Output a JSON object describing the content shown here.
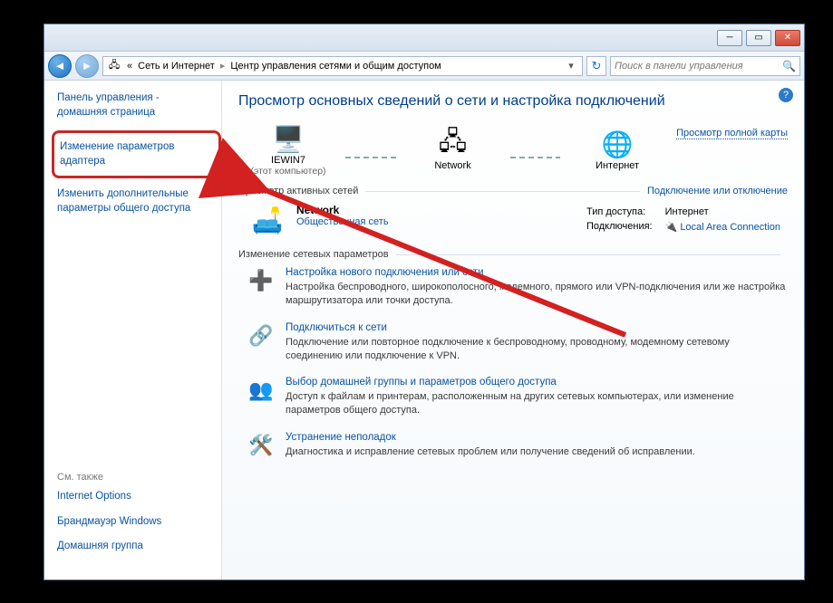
{
  "breadcrumb": {
    "prefix": "«",
    "seg1": "Сеть и Интернет",
    "seg2": "Центр управления сетями и общим доступом"
  },
  "search": {
    "placeholder": "Поиск в панели управления"
  },
  "sidebar": {
    "home": "Панель управления - домашняя страница",
    "adapter": "Изменение параметров адаптера",
    "sharing": "Изменить дополнительные параметры общего доступа",
    "see_also": "См. также",
    "internet_options": "Internet Options",
    "firewall": "Брандмауэр Windows",
    "homegroup": "Домашняя группа"
  },
  "main": {
    "heading": "Просмотр основных сведений о сети и настройка подключений",
    "map": {
      "node1": "IEWIN7",
      "node1_sub": "(этот компьютер)",
      "node2": "Network",
      "node3": "Интернет",
      "full_map": "Просмотр полной карты"
    },
    "active_hdr": "Просмотр активных сетей",
    "active_link": "Подключение или отключение",
    "network": {
      "name": "Network",
      "type": "Общественная сеть",
      "access_label": "Тип доступа:",
      "access_value": "Интернет",
      "conn_label": "Подключения:",
      "conn_value": "Local Area Connection"
    },
    "change_hdr": "Изменение сетевых параметров",
    "items": [
      {
        "title": "Настройка нового подключения или сети",
        "desc": "Настройка беспроводного, широкополосного, модемного, прямого или VPN-подключения или же настройка маршрутизатора или точки доступа."
      },
      {
        "title": "Подключиться к сети",
        "desc": "Подключение или повторное подключение к беспроводному, проводному, модемному сетевому соединению или подключение к VPN."
      },
      {
        "title": "Выбор домашней группы и параметров общего доступа",
        "desc": "Доступ к файлам и принтерам, расположенным на других сетевых компьютерах, или изменение параметров общего доступа."
      },
      {
        "title": "Устранение неполадок",
        "desc": "Диагностика и исправление сетевых проблем или получение сведений об исправлении."
      }
    ]
  }
}
